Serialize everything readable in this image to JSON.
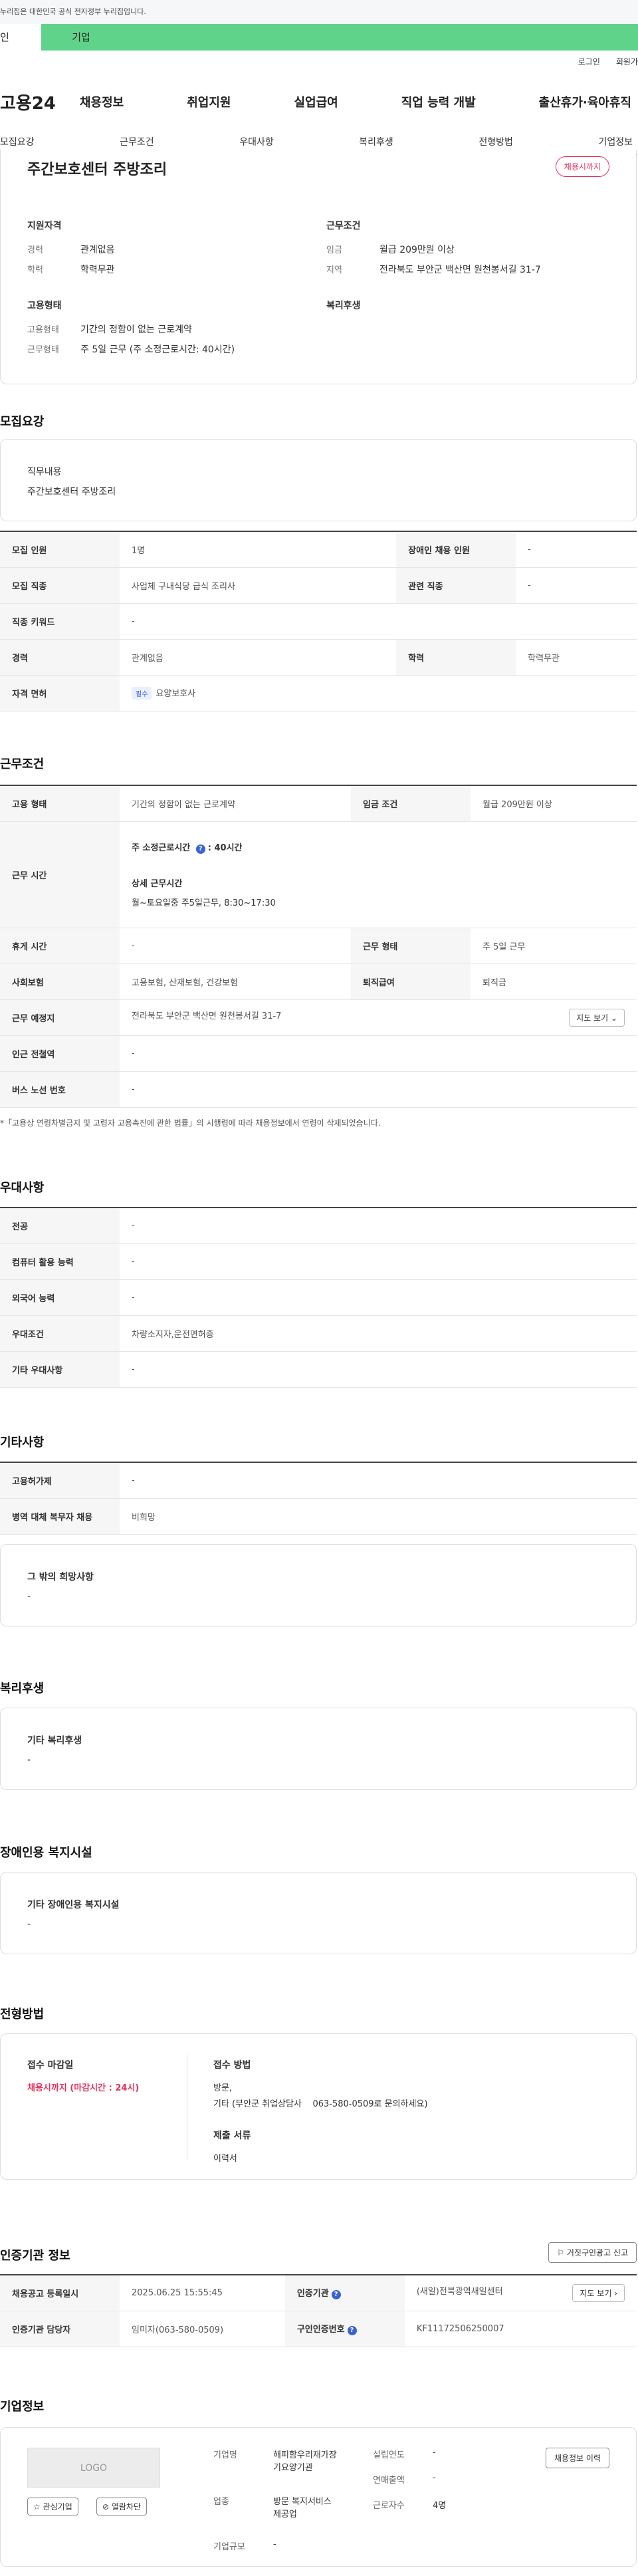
{
  "gov_banner": "누리집은 대한민국 공식 전자정부 누리집입니다.",
  "tabs": {
    "personal": "인",
    "corporate": "기업"
  },
  "top_links": {
    "login": "로그인",
    "join": "회원가"
  },
  "logo": "고용24",
  "gnb": [
    "채용정보",
    "취업지원",
    "실업급여",
    "직업 능력 개발",
    "출산휴가·육아휴직"
  ],
  "subnav": [
    "모집요강",
    "근무조건",
    "우대사항",
    "복리후생",
    "전형방법",
    "기업정보"
  ],
  "summary": {
    "title": "주간보호센터 주방조리",
    "badge": "채용시까지",
    "qual_header": "지원자격",
    "career_k": "경력",
    "career_v": "관계없음",
    "edu_k": "학력",
    "edu_v": "학력무관",
    "cond_header": "근무조건",
    "wage_k": "임금",
    "wage_v": "월급 209만원 이상",
    "area_k": "지역",
    "area_v": "전라북도 부안군 백산면 원천봉서길 31-7",
    "emp_header": "고용형태",
    "emptype_k": "고용형태",
    "emptype_v": "기간의 정함이 없는 근로계약",
    "worktype_k": "근무형태",
    "worktype_v": "주 5일 근무 (주 소정근로시간: 40시간)",
    "welfare_header": "복리후생"
  },
  "recruit": {
    "title": "모집요강",
    "duty_label": "직무내용",
    "duty_value": "주간보호센터 주방조리",
    "rows": [
      [
        "모집 인원",
        "1명",
        "장애인 채용 인원",
        "-"
      ],
      [
        "모집 직종",
        "사업체 구내식당 급식 조리사",
        "관련 직종",
        "-"
      ],
      [
        "직종 키워드",
        "-"
      ],
      [
        "경력",
        "관계없음",
        "학력",
        "학력무관"
      ],
      [
        "자격 면허",
        "요양보호사"
      ]
    ],
    "license_chip": "필수"
  },
  "conditions": {
    "title": "근무조건",
    "emp_k": "고용 형태",
    "emp_v": "기간의 정함이 없는 근로계약",
    "wage_k": "임금 조건",
    "wage_v": "월급 209만원 이상",
    "hours_k": "근무 시간",
    "hours_weekly": "주 소정근로시간",
    "hours_weekly_v": ": 40시간",
    "hours_detail_label": "상세 근무시간",
    "hours_detail": "월~토요일중 주5일근무, 8:30~17:30",
    "break_k": "휴게 시간",
    "break_v": "-",
    "form_k": "근무 형태",
    "form_v": "주 5일 근무",
    "ins_k": "사회보험",
    "ins_v": "고용보험, 산재보험, 건강보험",
    "retire_k": "퇴직급여",
    "retire_v": "퇴직금",
    "place_k": "근무 예정지",
    "place_v": "전라북도 부안군 백산면 원천봉서길 31-7",
    "map_btn": "지도 보기",
    "station_k": "인근 전철역",
    "station_v": "-",
    "bus_k": "버스 노선 번호",
    "bus_v": "-",
    "note": "*「고용상 연령차별금지 및 고령자 고용촉진에 관한 법률」의 시행령에 따라 채용정보에서 연령이 삭제되었습니다."
  },
  "preference": {
    "title": "우대사항",
    "rows": [
      [
        "전공",
        "-"
      ],
      [
        "컴퓨터 활용 능력",
        "-"
      ],
      [
        "외국어 능력",
        "-"
      ],
      [
        "우대조건",
        "차량소지자,운전면허증"
      ],
      [
        "기타 우대사항",
        "-"
      ]
    ]
  },
  "others": {
    "title": "기타사항",
    "rows": [
      [
        "고용허가제",
        "-"
      ],
      [
        "병역 대체 복무자 채용",
        "비희망"
      ]
    ],
    "extra_label": "그 밖의 희망사항",
    "extra_value": "-"
  },
  "welfare": {
    "title": "복리후생",
    "label": "기타 복리후생",
    "value": "-"
  },
  "disabled": {
    "title": "장애인용 복지시설",
    "label": "기타 장애인용 복지시설",
    "value": "-"
  },
  "selection": {
    "title": "전형방법",
    "deadline_label": "접수 마감일",
    "deadline_value": "채용시까지 (마감시간 : 24시)",
    "method_label": "접수 방법",
    "method_line1": "방문,",
    "method_line2": "기타 (부안군 취업상담사    063-580-0509로 문의하세요)",
    "docs_label": "제출 서류",
    "docs_value": "이력서"
  },
  "agency": {
    "title": "인증기관 정보",
    "report_btn": "거짓구인광고 신고",
    "reg_k": "채용공고 등록일시",
    "reg_v": "2025.06.25 15:55:45",
    "org_k": "인증기관",
    "org_v": "(새일)전북광역새일센터",
    "map_btn": "지도 보기",
    "mgr_k": "인증기관 담당자",
    "mgr_v": "임미자(063-580-0509)",
    "no_k": "구인인증번호",
    "no_v": "KF11172506250007"
  },
  "company": {
    "title": "기업정보",
    "logo": "LOGO",
    "fav_btn": "관심기업",
    "block_btn": "열람차단",
    "history_btn": "채용정보 이력",
    "name_k": "기업명",
    "name_v1": "해피함우리재가장",
    "name_v2": "기요양기관",
    "ind_k": "업종",
    "ind_v1": "방문 복지서비스",
    "ind_v2": "제공업",
    "size_k": "기업규모",
    "size_v": "-",
    "est_k": "설립연도",
    "est_v": "-",
    "sales_k": "연매출액",
    "sales_v": "-",
    "emp_k": "근로자수",
    "emp_v": "4명"
  }
}
